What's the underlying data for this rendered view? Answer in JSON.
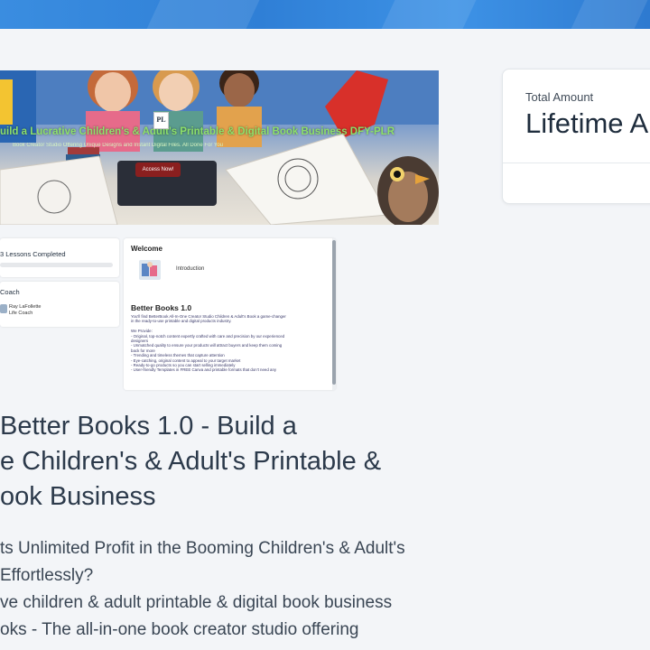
{
  "colors": {
    "topbar": "#2f7fd6",
    "page_bg": "#f3f5f8",
    "hero_title": "#8de06a",
    "cta_bg": "#8a1f1f",
    "text_dark": "#2c3a4b"
  },
  "hero": {
    "title": "uild a Lucrative Children's & Adult's Printable & Digital Book Business DFY-PLR",
    "subtitle": "Book Creator Studio Offering Unique Designs and Instant Digital Files. All Done For You",
    "logo_text": "PL",
    "cta_label": "Access Now!"
  },
  "sidebar_preview": {
    "lessons_completed": "3 Lessons Completed",
    "progress_percent": 0,
    "coach_title": "Coach",
    "coach_name": "Ray LaFollette",
    "coach_role": "Life Coach"
  },
  "content_preview": {
    "welcome": "Welcome",
    "lesson_item": "Introduction",
    "title": "Better Books 1.0",
    "body_lines": [
      "You'll find BetterBook All-In-One Creator Studio Children & Adult's Book a game-changer",
      "in the ready-to-use printable and digital products industry.",
      "",
      "We Provide:",
      "- Original, top-notch content expertly crafted with care and precision by our experienced",
      "designers",
      "- Unmatched quality to ensure your products will attract buyers and keep them coming",
      "back for more",
      "- Trending and timeless themes that capture attention",
      "- Eye-catching, original content to appeal to your target market",
      "- Ready-to-go products so you can start selling immediately",
      "- User-friendly Templates in FREE Canva and printable formats that don't need any"
    ]
  },
  "course": {
    "title_lines": [
      "Better Books 1.0 - Build a",
      "e Children's & Adult's Printable &",
      "ook Business"
    ],
    "description_lines": [
      "ts Unlimited Profit in the Booming Children's & Adult's",
      " Effortlessly?",
      "ve children & adult printable & digital book business",
      "oks - The all-in-one book creator studio offering"
    ]
  },
  "amount_panel": {
    "label": "Total Amount",
    "value": "Lifetime A"
  }
}
